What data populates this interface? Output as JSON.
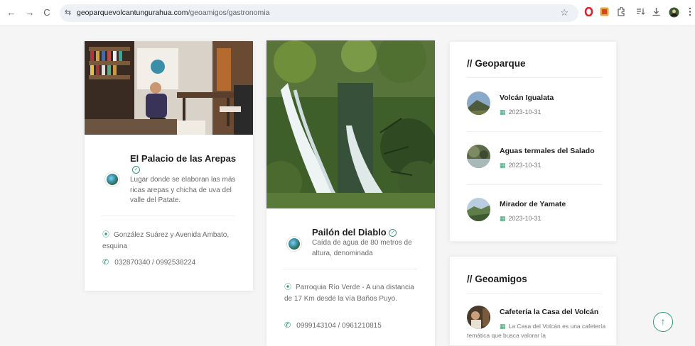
{
  "browser": {
    "url_domain": "geoparquevolcantungurahua.com",
    "url_path": "/geoamigos/gastronomia",
    "back": "←",
    "forward": "→",
    "reload": "C",
    "site_info": "⇆",
    "star": "☆"
  },
  "cards": [
    {
      "title": "El Palacio de las Arepas",
      "verified": "✓",
      "description": "Lugar donde se elaboran las más ricas arepas y chicha de uva del valle del Patate.",
      "address": "González Suárez y Avenida Ambato, esquina",
      "phone": "032870340 / 0992538224"
    },
    {
      "title": "Pailón del Diablo",
      "verified": "✓",
      "description": "Caída de agua de 80 metros de altura, denominada",
      "address": "Parroquia Río Verde - A una distancia de 17 Km desde la vía Baños Puyo.",
      "phone": "0999143104 / 0961210815"
    }
  ],
  "sidebar": {
    "geoparque": {
      "heading": "// Geoparque",
      "posts": [
        {
          "title": "Volcán Igualata",
          "date": "2023-10-31"
        },
        {
          "title": "Aguas termales del Salado",
          "date": "2023-10-31"
        },
        {
          "title": "Mirador de Yamate",
          "date": "2023-10-31"
        }
      ]
    },
    "geoamigos": {
      "heading": "// Geoamigos",
      "posts": [
        {
          "title": "Cafetería la Casa del Volcán",
          "desc": "La Casa del Volcán es una cafetería temática que busca valorar la"
        }
      ]
    }
  },
  "scroll_top": "↑",
  "colors": {
    "accent": "#2f9b6f",
    "background": "#f5f5f6"
  }
}
